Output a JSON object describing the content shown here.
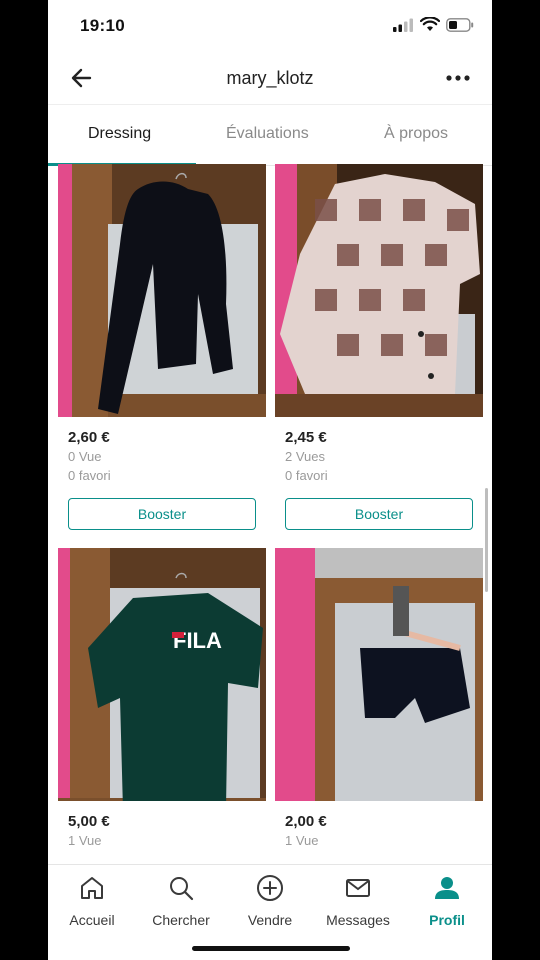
{
  "status": {
    "time": "19:10"
  },
  "header": {
    "title": "mary_klotz"
  },
  "tabs": [
    {
      "label": "Dressing",
      "active": true
    },
    {
      "label": "Évaluations",
      "active": false
    },
    {
      "label": "À propos",
      "active": false
    }
  ],
  "items": [
    {
      "price": "2,60 €",
      "views": "0 Vue",
      "favs": "0 favori",
      "button": "Booster"
    },
    {
      "price": "2,45 €",
      "views": "2 Vues",
      "favs": "0 favori",
      "button": "Booster"
    },
    {
      "price": "5,00 €",
      "views": "1 Vue",
      "shirt_text": "FILA"
    },
    {
      "price": "2,00 €",
      "views": "1 Vue"
    }
  ],
  "nav": [
    {
      "label": "Accueil",
      "icon": "home-icon"
    },
    {
      "label": "Chercher",
      "icon": "search-icon"
    },
    {
      "label": "Vendre",
      "icon": "plus-circle-icon"
    },
    {
      "label": "Messages",
      "icon": "mail-icon"
    },
    {
      "label": "Profil",
      "icon": "person-icon",
      "active": true
    }
  ],
  "colors": {
    "accent": "#0a8f8a",
    "text": "#222222",
    "muted": "#9a9a9a"
  }
}
